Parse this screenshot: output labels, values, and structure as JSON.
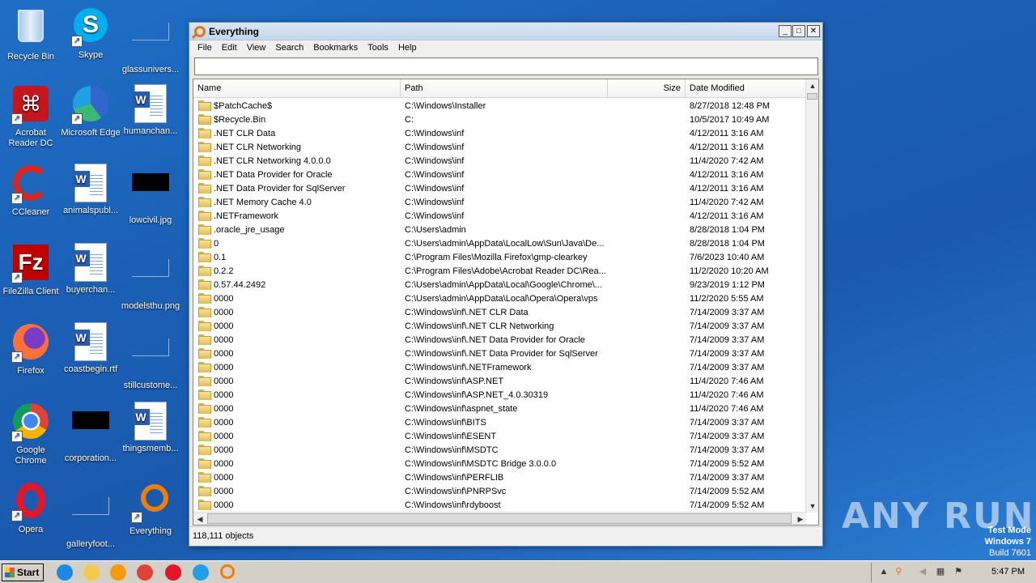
{
  "desktop": {
    "icons": [
      {
        "label": "Recycle Bin"
      },
      {
        "label": "Skype"
      },
      {
        "label": "glassunivers..."
      },
      {
        "label": "Acrobat Reader DC"
      },
      {
        "label": "Microsoft Edge"
      },
      {
        "label": "humanchan..."
      },
      {
        "label": "CCleaner"
      },
      {
        "label": "animalspubl..."
      },
      {
        "label": "lowcivil.jpg"
      },
      {
        "label": "FileZilla Client"
      },
      {
        "label": "buyerchan..."
      },
      {
        "label": "modelsthu.png"
      },
      {
        "label": "Firefox"
      },
      {
        "label": "coastbegin.rtf"
      },
      {
        "label": "stillcustome..."
      },
      {
        "label": "Google Chrome"
      },
      {
        "label": "corporation..."
      },
      {
        "label": "thingsmemb..."
      },
      {
        "label": "Opera"
      },
      {
        "label": "galleryfoot..."
      },
      {
        "label": "Everything"
      }
    ],
    "watermark": "ANY RUN",
    "test_mode": {
      "line1": "Test Mode",
      "line2": "Windows 7",
      "line3": "Build 7601"
    }
  },
  "window": {
    "title": "Everything",
    "menu": [
      "File",
      "Edit",
      "View",
      "Search",
      "Bookmarks",
      "Tools",
      "Help"
    ],
    "search_value": "",
    "columns": {
      "name": "Name",
      "path": "Path",
      "size": "Size",
      "date": "Date Modified"
    },
    "rows": [
      {
        "name": "$PatchCache$",
        "path": "C:\\Windows\\Installer",
        "size": "",
        "date": "8/27/2018 12:48 PM"
      },
      {
        "name": "$Recycle.Bin",
        "path": "C:",
        "size": "",
        "date": "10/5/2017 10:49 AM"
      },
      {
        "name": ".NET CLR Data",
        "path": "C:\\Windows\\inf",
        "size": "",
        "date": "4/12/2011 3:16 AM"
      },
      {
        "name": ".NET CLR Networking",
        "path": "C:\\Windows\\inf",
        "size": "",
        "date": "4/12/2011 3:16 AM"
      },
      {
        "name": ".NET CLR Networking 4.0.0.0",
        "path": "C:\\Windows\\inf",
        "size": "",
        "date": "11/4/2020 7:42 AM"
      },
      {
        "name": ".NET Data Provider for Oracle",
        "path": "C:\\Windows\\inf",
        "size": "",
        "date": "4/12/2011 3:16 AM"
      },
      {
        "name": ".NET Data Provider for SqlServer",
        "path": "C:\\Windows\\inf",
        "size": "",
        "date": "4/12/2011 3:16 AM"
      },
      {
        "name": ".NET Memory Cache 4.0",
        "path": "C:\\Windows\\inf",
        "size": "",
        "date": "11/4/2020 7:42 AM"
      },
      {
        "name": ".NETFramework",
        "path": "C:\\Windows\\inf",
        "size": "",
        "date": "4/12/2011 3:16 AM"
      },
      {
        "name": ".oracle_jre_usage",
        "path": "C:\\Users\\admin",
        "size": "",
        "date": "8/28/2018 1:04 PM"
      },
      {
        "name": "0",
        "path": "C:\\Users\\admin\\AppData\\LocalLow\\Sun\\Java\\De...",
        "size": "",
        "date": "8/28/2018 1:04 PM"
      },
      {
        "name": "0.1",
        "path": "C:\\Program Files\\Mozilla Firefox\\gmp-clearkey",
        "size": "",
        "date": "7/6/2023 10:40 AM"
      },
      {
        "name": "0.2.2",
        "path": "C:\\Program Files\\Adobe\\Acrobat Reader DC\\Rea...",
        "size": "",
        "date": "11/2/2020 10:20 AM"
      },
      {
        "name": "0.57.44.2492",
        "path": "C:\\Users\\admin\\AppData\\Local\\Google\\Chrome\\...",
        "size": "",
        "date": "9/23/2019 1:12 PM"
      },
      {
        "name": "0000",
        "path": "C:\\Users\\admin\\AppData\\Local\\Opera\\Opera\\vps",
        "size": "",
        "date": "11/2/2020 5:55 AM"
      },
      {
        "name": "0000",
        "path": "C:\\Windows\\inf\\.NET CLR Data",
        "size": "",
        "date": "7/14/2009 3:37 AM"
      },
      {
        "name": "0000",
        "path": "C:\\Windows\\inf\\.NET CLR Networking",
        "size": "",
        "date": "7/14/2009 3:37 AM"
      },
      {
        "name": "0000",
        "path": "C:\\Windows\\inf\\.NET Data Provider for Oracle",
        "size": "",
        "date": "7/14/2009 3:37 AM"
      },
      {
        "name": "0000",
        "path": "C:\\Windows\\inf\\.NET Data Provider for SqlServer",
        "size": "",
        "date": "7/14/2009 3:37 AM"
      },
      {
        "name": "0000",
        "path": "C:\\Windows\\inf\\.NETFramework",
        "size": "",
        "date": "7/14/2009 3:37 AM"
      },
      {
        "name": "0000",
        "path": "C:\\Windows\\inf\\ASP.NET",
        "size": "",
        "date": "11/4/2020 7:46 AM"
      },
      {
        "name": "0000",
        "path": "C:\\Windows\\inf\\ASP.NET_4.0.30319",
        "size": "",
        "date": "11/4/2020 7:46 AM"
      },
      {
        "name": "0000",
        "path": "C:\\Windows\\inf\\aspnet_state",
        "size": "",
        "date": "11/4/2020 7:46 AM"
      },
      {
        "name": "0000",
        "path": "C:\\Windows\\inf\\BITS",
        "size": "",
        "date": "7/14/2009 3:37 AM"
      },
      {
        "name": "0000",
        "path": "C:\\Windows\\inf\\ESENT",
        "size": "",
        "date": "7/14/2009 3:37 AM"
      },
      {
        "name": "0000",
        "path": "C:\\Windows\\inf\\MSDTC",
        "size": "",
        "date": "7/14/2009 3:37 AM"
      },
      {
        "name": "0000",
        "path": "C:\\Windows\\inf\\MSDTC Bridge 3.0.0.0",
        "size": "",
        "date": "7/14/2009 5:52 AM"
      },
      {
        "name": "0000",
        "path": "C:\\Windows\\inf\\PERFLIB",
        "size": "",
        "date": "7/14/2009 3:37 AM"
      },
      {
        "name": "0000",
        "path": "C:\\Windows\\inf\\PNRPSvc",
        "size": "",
        "date": "7/14/2009 5:52 AM"
      },
      {
        "name": "0000",
        "path": "C:\\Windows\\inf\\rdyboost",
        "size": "",
        "date": "7/14/2009 5:52 AM"
      }
    ],
    "status": "118,111 objects"
  },
  "taskbar": {
    "start_label": "Start",
    "clock": "5:47 PM",
    "pinned": [
      "internet-explorer-icon",
      "file-explorer-icon",
      "media-player-icon",
      "chrome-icon",
      "opera-icon",
      "edge-icon",
      "everything-icon"
    ]
  }
}
